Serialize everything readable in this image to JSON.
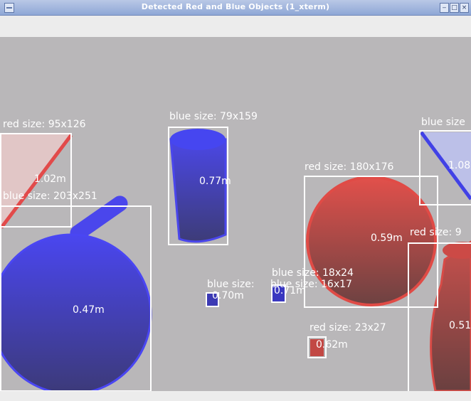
{
  "window": {
    "title": "Detected Red and Blue Objects (1_xterm)",
    "buttons": [
      "minimize",
      "maximize",
      "close"
    ]
  },
  "colors": {
    "red": "#d24b46",
    "blue": "#3b3be6",
    "box": "#ffffff",
    "background": "#b9b7b9"
  },
  "detections": [
    {
      "id": "red-triangle",
      "label": "red size: 95x126",
      "distance": "1.02m"
    },
    {
      "id": "blue-sphere",
      "label": "blue size: 203x251",
      "distance": "0.47m"
    },
    {
      "id": "blue-cylinder",
      "label": "blue size: 79x159",
      "distance": "0.77m"
    },
    {
      "id": "blue-small-1",
      "label": "blue size: ",
      "distance": "0.70m"
    },
    {
      "id": "blue-small-2",
      "label": "blue size: 16x17",
      "distance": "0.71m"
    },
    {
      "id": "red-sphere",
      "label": "red size: 180x176",
      "distance": "0.59m"
    },
    {
      "id": "blue-triangle",
      "label": "blue size",
      "distance": "1.08"
    },
    {
      "id": "red-cylinder",
      "label": "red size: 9",
      "distance": "0.51"
    },
    {
      "id": "red-small",
      "label": "red size: 23x27",
      "distance": "0.62m"
    }
  ],
  "extra_labels": {
    "overlap": "blue size: 18x24"
  }
}
